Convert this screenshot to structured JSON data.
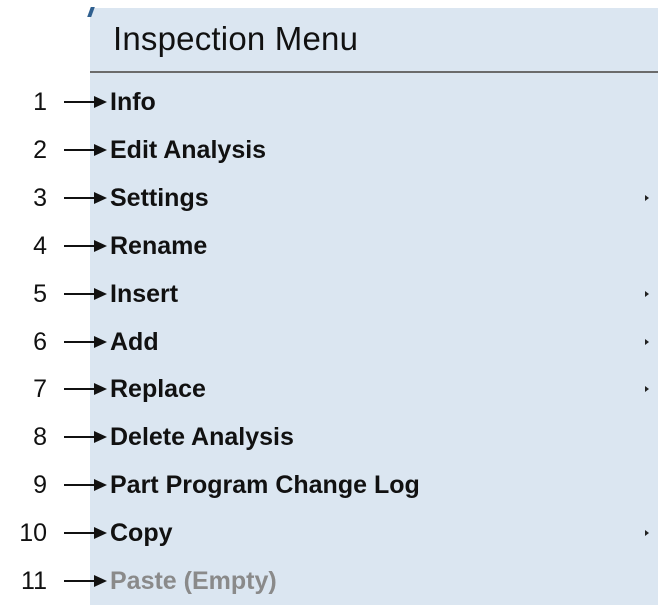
{
  "menu": {
    "title": "Inspection Menu",
    "items": [
      {
        "number": "1",
        "label": "Info",
        "has_submenu": false,
        "disabled": false
      },
      {
        "number": "2",
        "label": "Edit Analysis",
        "has_submenu": false,
        "disabled": false
      },
      {
        "number": "3",
        "label": "Settings",
        "has_submenu": true,
        "disabled": false
      },
      {
        "number": "4",
        "label": "Rename",
        "has_submenu": false,
        "disabled": false
      },
      {
        "number": "5",
        "label": "Insert",
        "has_submenu": true,
        "disabled": false
      },
      {
        "number": "6",
        "label": "Add",
        "has_submenu": true,
        "disabled": false
      },
      {
        "number": "7",
        "label": "Replace",
        "has_submenu": true,
        "disabled": false
      },
      {
        "number": "8",
        "label": "Delete Analysis",
        "has_submenu": false,
        "disabled": false
      },
      {
        "number": "9",
        "label": "Part Program Change Log",
        "has_submenu": false,
        "disabled": false
      },
      {
        "number": "10",
        "label": "Copy",
        "has_submenu": true,
        "disabled": false
      },
      {
        "number": "11",
        "label": "Paste (Empty)",
        "has_submenu": false,
        "disabled": true
      }
    ]
  },
  "colors": {
    "menu_background": "#dbe6f1",
    "text": "#111111",
    "disabled_text": "#8a8a8a",
    "separator": "#6b6b6b"
  },
  "icons": {
    "callout": "right-arrow-icon",
    "submenu": "submenu-arrow-icon"
  }
}
